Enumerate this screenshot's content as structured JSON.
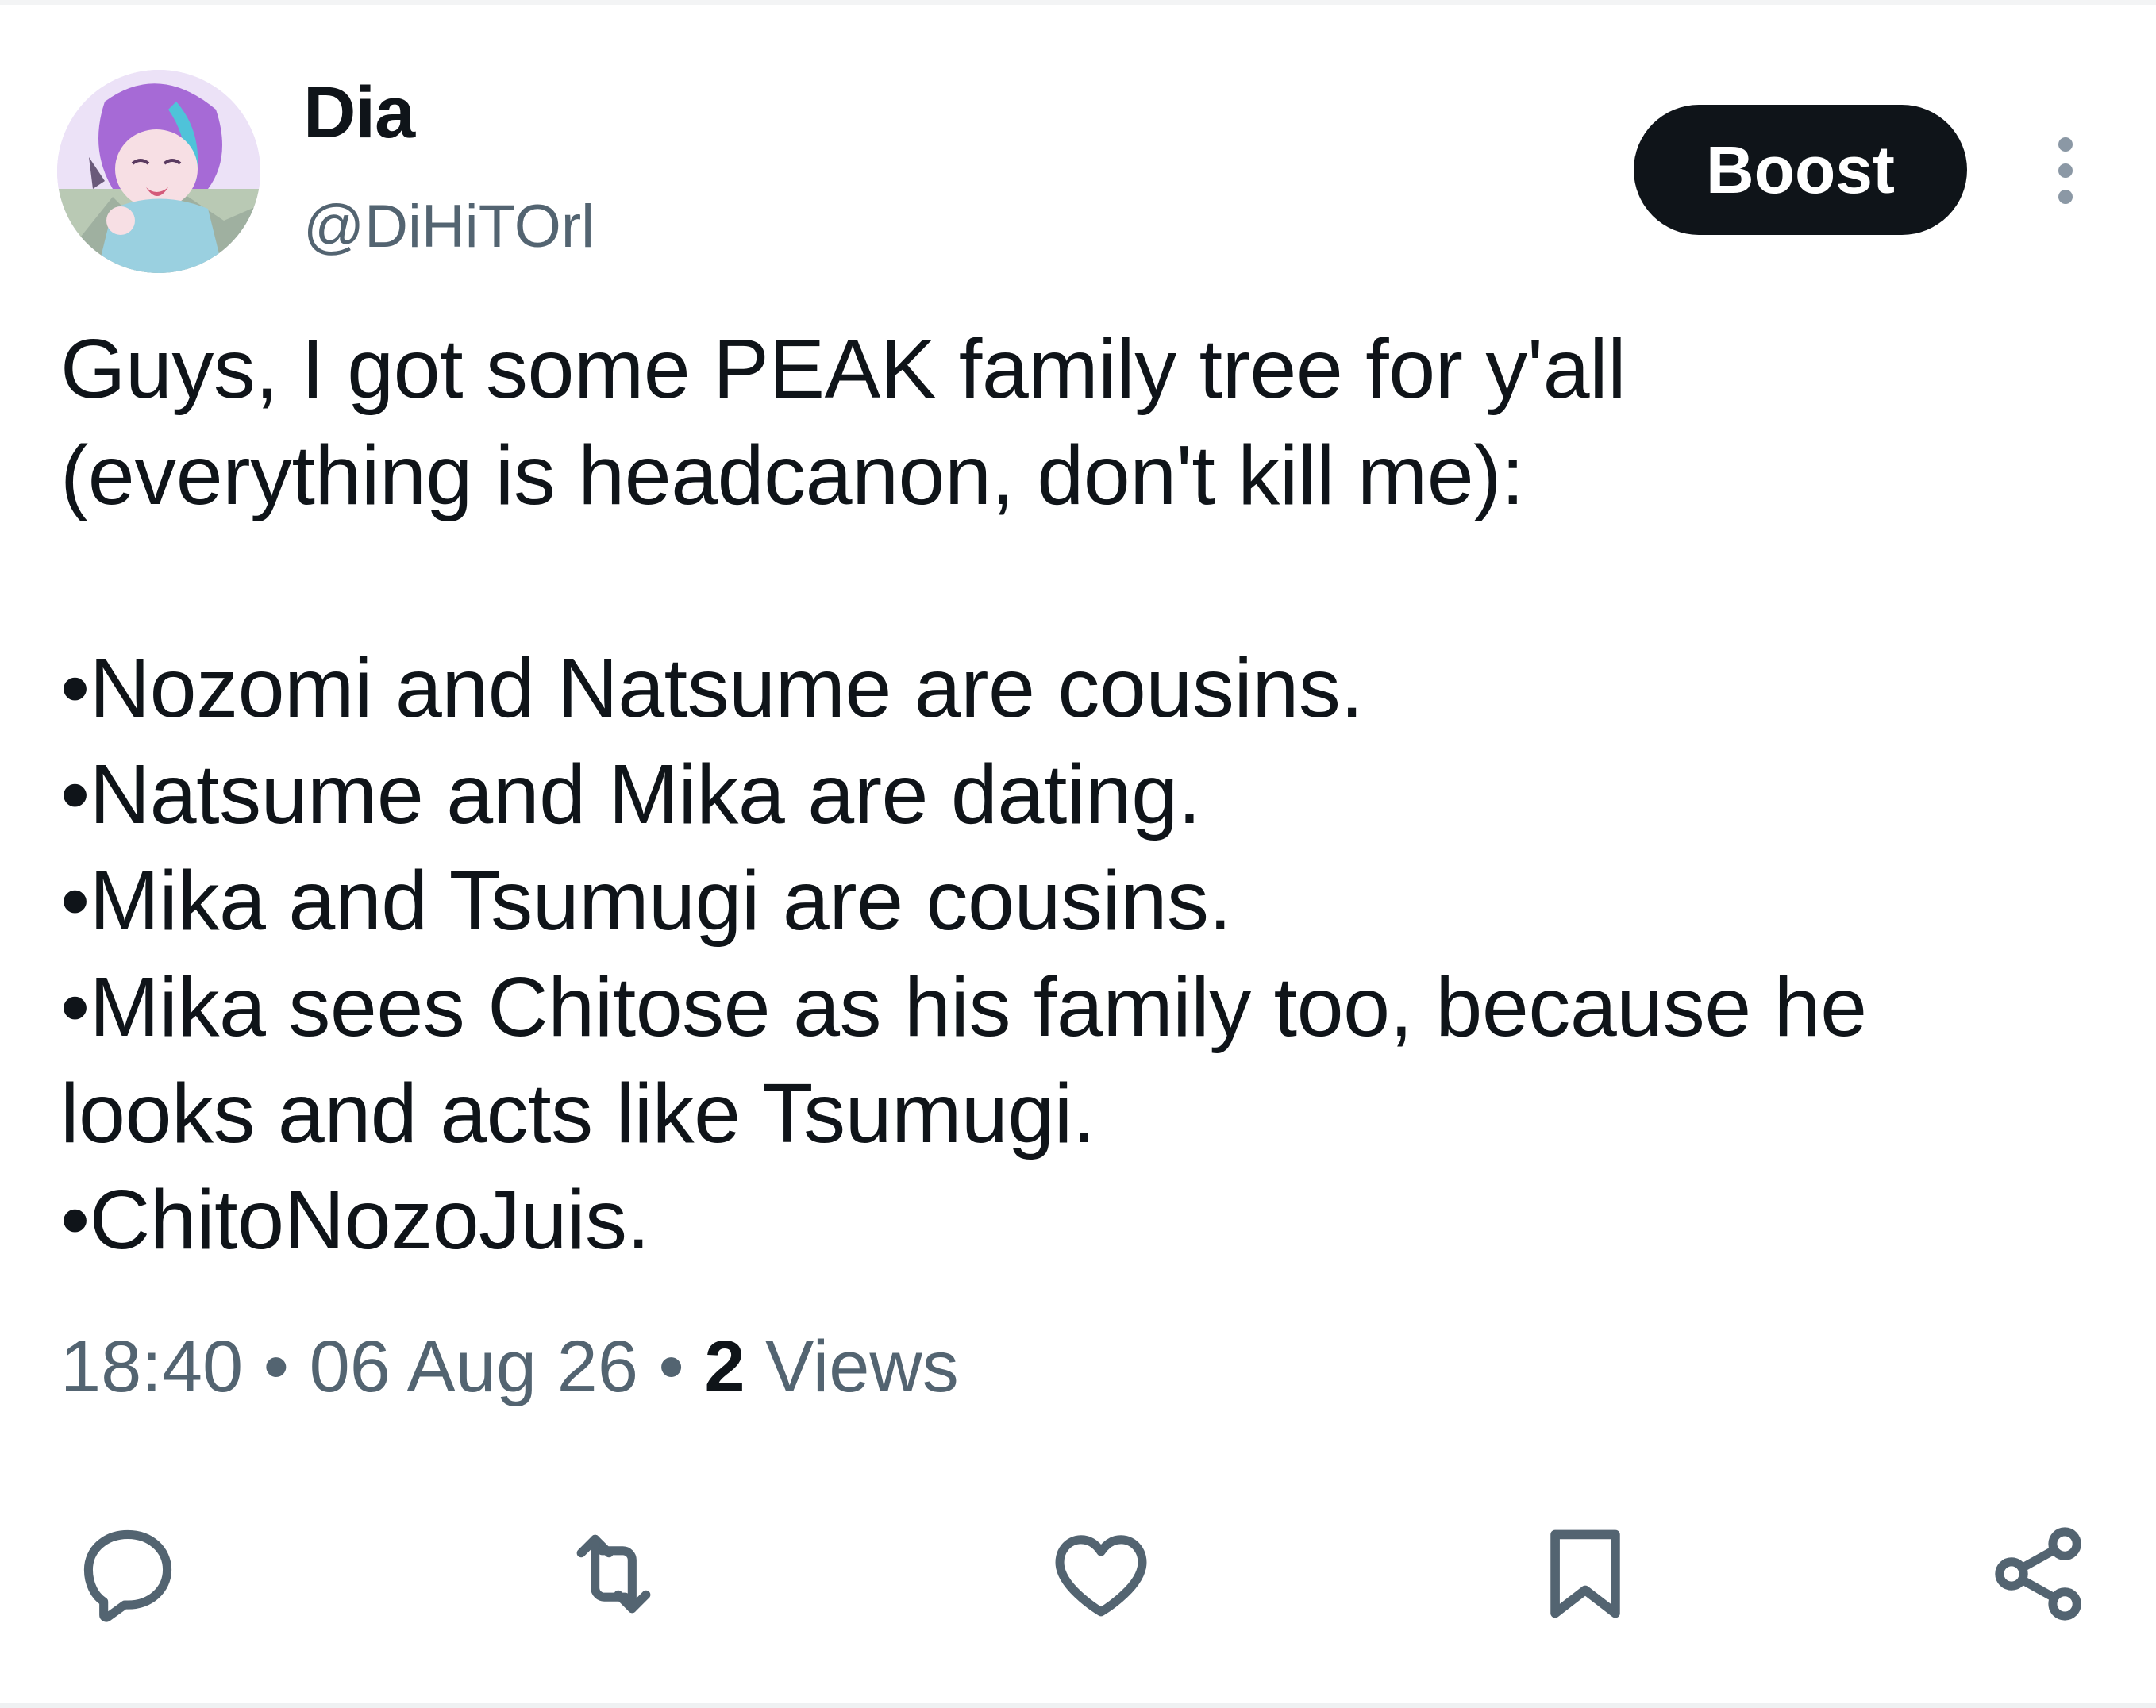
{
  "tweet": {
    "display_name": "Dia",
    "handle": "@DiHiTOrl",
    "boost_label": "Boost",
    "text_lines": [
      "Guys, I got some PEAK family tree for y'all",
      "(everything is headcanon, don't kill me):",
      "",
      "•Nozomi and Natsume are cousins.",
      "•Natsume and Mika are dating.",
      "•Mika and Tsumugi are cousins.",
      "•Mika sees Chitose as his family too, because he",
      "looks and acts like Tsumugi.",
      "•ChitoNozoJuis."
    ],
    "time": "18:40",
    "separator": " • ",
    "date": "06 Aug 26",
    "views_count": "2",
    "views_label": " Views"
  },
  "icons": {
    "more": "more-vertical-icon",
    "reply": "reply-icon",
    "retweet": "retweet-icon",
    "like": "heart-icon",
    "bookmark": "bookmark-icon",
    "share": "share-icon"
  },
  "colors": {
    "text": "#0f1419",
    "secondary": "#536471",
    "button_bg": "#0f1419",
    "button_text": "#ffffff"
  }
}
